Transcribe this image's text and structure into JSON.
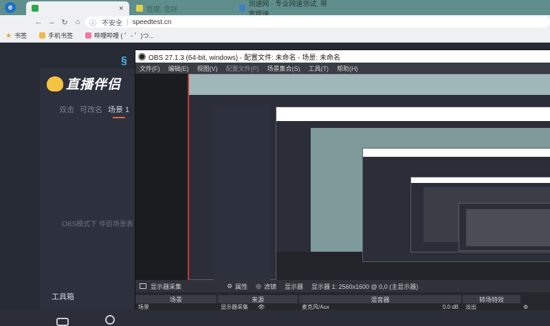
{
  "browser": {
    "tabs": [
      {
        "label": "",
        "active": true
      },
      {
        "label": "百度, 您好",
        "active": false
      },
      {
        "label": "测速网 - 专业网速测试, 带宽提速",
        "active": false
      }
    ],
    "address": {
      "security": "不安全",
      "url": "speedtest.cn"
    },
    "bookmarks": [
      "书签",
      "手机书签",
      "哔哩哔哩 ( ゜- ゜)つ..."
    ]
  },
  "companion": {
    "logo": "直播伴侣",
    "tabs": [
      "双击",
      "可改名",
      "场景 1"
    ],
    "obs_note": "OBS模式下 伴侣场景表",
    "tools_label": "工具箱"
  },
  "obs": {
    "title": "OBS 27.1.3 (64-bit, windows) - 配置文件: 未命名 - 场景: 未命名",
    "menu": [
      "文件(F)",
      "编辑(E)",
      "视图(V)",
      "配置文件(P)",
      "场景集合(S)",
      "工具(T)",
      "帮助(H)"
    ],
    "source_bar": {
      "source_name": "显示器采集",
      "properties": "属性",
      "filters": "滤镜",
      "display_label": "显示器",
      "display_info": "显示器 1: 2560x1600 @ 0,0 (主显示器)"
    },
    "docks": {
      "scenes": "场景",
      "sources": "来源",
      "mixer": "混音器",
      "transitions": "转场特效",
      "scene_item": "场景",
      "source_item": "显示器采集",
      "mixer_item": "麦克风/Aux",
      "mixer_level": "0.0 dB",
      "transition_item": "淡出"
    }
  }
}
